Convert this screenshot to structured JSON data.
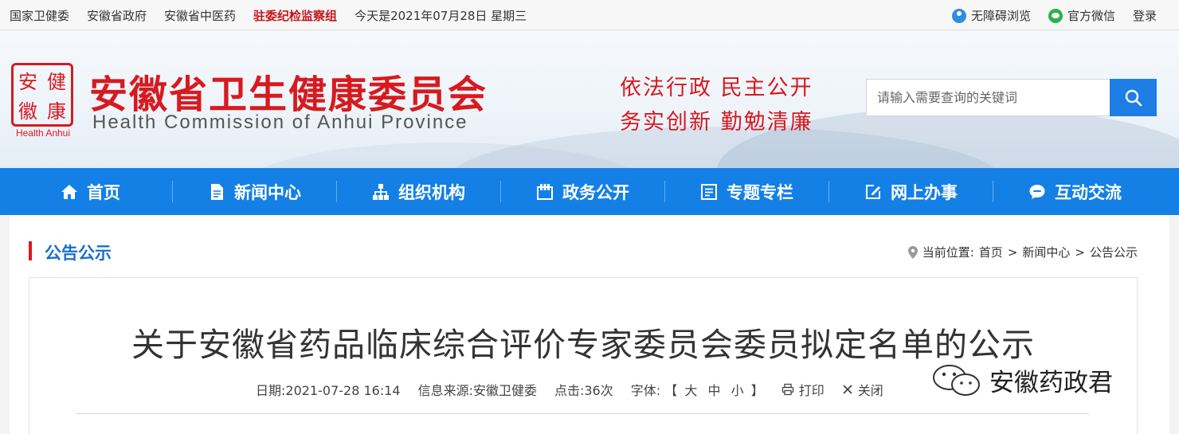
{
  "topbar": {
    "links": [
      "国家卫健委",
      "安徽省政府",
      "安徽省中医药"
    ],
    "highlight_link": "驻委纪检监察组",
    "date_text": "今天是2021年07月28日 星期三",
    "accessibility": "无障碍浏览",
    "wechat": "官方微信",
    "login": "登录"
  },
  "header": {
    "seal_chars": [
      "安",
      "健",
      "徽",
      "康"
    ],
    "logo_en": "Health Anhui",
    "title": "安徽省卫生健康委员会",
    "subtitle": "Health Commission of Anhui Province",
    "slogan_line1": "依法行政  民主公开",
    "slogan_line2": "务实创新  勤勉清廉",
    "search_placeholder": "请输入需要查询的关键词"
  },
  "nav": {
    "items": [
      {
        "label": "首页",
        "icon": "home-icon"
      },
      {
        "label": "新闻中心",
        "icon": "document-icon"
      },
      {
        "label": "组织机构",
        "icon": "org-chart-icon"
      },
      {
        "label": "政务公开",
        "icon": "folder-icon"
      },
      {
        "label": "专题专栏",
        "icon": "list-icon"
      },
      {
        "label": "网上办事",
        "icon": "edit-icon"
      },
      {
        "label": "互动交流",
        "icon": "chat-icon"
      }
    ]
  },
  "section": {
    "title": "公告公示",
    "breadcrumb_label": "当前位置:",
    "breadcrumb": [
      "首页",
      "新闻中心",
      "公告公示"
    ],
    "separator": ">"
  },
  "article": {
    "title": "关于安徽省药品临床综合评价专家委员会委员拟定名单的公示",
    "date": "日期:2021-07-28 16:14",
    "source": "信息来源:安徽卫健委",
    "clicks": "点击:36次",
    "font_label": "字体:",
    "font_open": "【",
    "font_sizes": [
      "大",
      "中",
      "小"
    ],
    "font_close": "】",
    "print": "打印",
    "close": "关闭"
  },
  "watermark": {
    "text": "安徽药政君"
  },
  "colors": {
    "brand_red": "#d71a1f",
    "nav_blue": "#1480e6",
    "section_blue": "#1a6fcd"
  }
}
